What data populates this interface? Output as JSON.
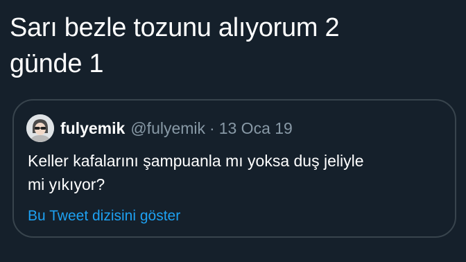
{
  "tweet": {
    "text_line1": "Sarı bezle tozunu alıyorum 2",
    "text_line2": "günde 1"
  },
  "quoted_tweet": {
    "avatar_icon": "user-avatar-icon",
    "display_name": "fulyemik",
    "handle": "@fulyemik",
    "separator": "·",
    "date": "13 Oca 19",
    "text_line1": "Keller kafalarını şampuanla mı yoksa duş jeliyle",
    "text_line2": "mi yıkıyor?",
    "thread_link": "Bu Tweet dizisini göster"
  },
  "colors": {
    "background": "#15202b",
    "text": "#ffffff",
    "secondary": "#8899a6",
    "link": "#1da1f2",
    "border": "#38444d"
  }
}
